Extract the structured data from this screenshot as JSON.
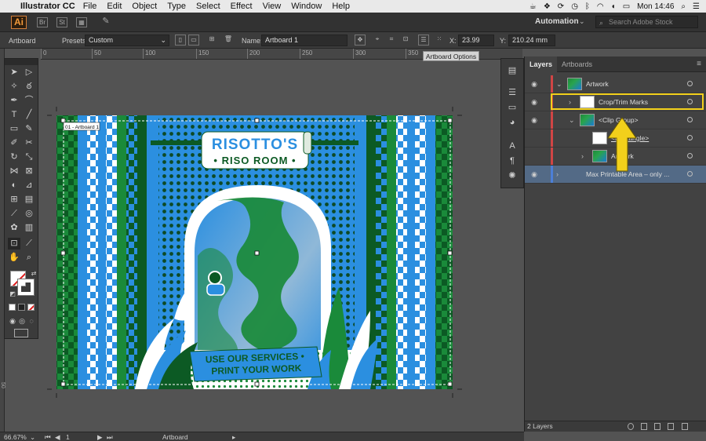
{
  "menubar": {
    "app_name": "Illustrator CC",
    "items": [
      "File",
      "Edit",
      "Object",
      "Type",
      "Select",
      "Effect",
      "View",
      "Window",
      "Help"
    ],
    "clock": "Mon 14:46"
  },
  "appbar": {
    "logo": "Ai",
    "workspace": "Automation",
    "stock_placeholder": "Search Adobe Stock"
  },
  "controlbar": {
    "mode_label": "Artboard",
    "presets_label": "Presets:",
    "presets_value": "Custom",
    "name_label": "Name:",
    "name_value": "Artboard 1",
    "x_label": "X:",
    "x_value": "23.99 mm",
    "y_label": "Y:",
    "y_value": "210.24 mm"
  },
  "ruler": {
    "ticks": [
      "0",
      "50",
      "100",
      "150",
      "200",
      "250",
      "300",
      "350"
    ],
    "vertical_tick": "50"
  },
  "tooltip": "Artboard Options",
  "artwork": {
    "artboard_label": "01 - Artboard 1",
    "title_line1": "RISOTTO'S",
    "title_line2": "• RISO ROOM •",
    "banner_line1": "USE OUR SERVICES •",
    "banner_line2": "PRINT YOUR WORK",
    "colors": {
      "green": "#1a8a3a",
      "blue": "#2b8fe0",
      "dark_green": "#0c5a24"
    }
  },
  "layers_panel": {
    "tabs": [
      "Layers",
      "Artboards"
    ],
    "rows": [
      {
        "name": "Artwork"
      },
      {
        "name": "Crop/Trim Marks"
      },
      {
        "name": "<Clip Group>"
      },
      {
        "name": "<Rectangle>"
      },
      {
        "name": "Artwork"
      },
      {
        "name": "Max Printable Area – only ..."
      }
    ],
    "footer": "2 Layers"
  },
  "statusbar": {
    "zoom": "66.67%",
    "artboard_number": "1",
    "mode": "Artboard"
  }
}
